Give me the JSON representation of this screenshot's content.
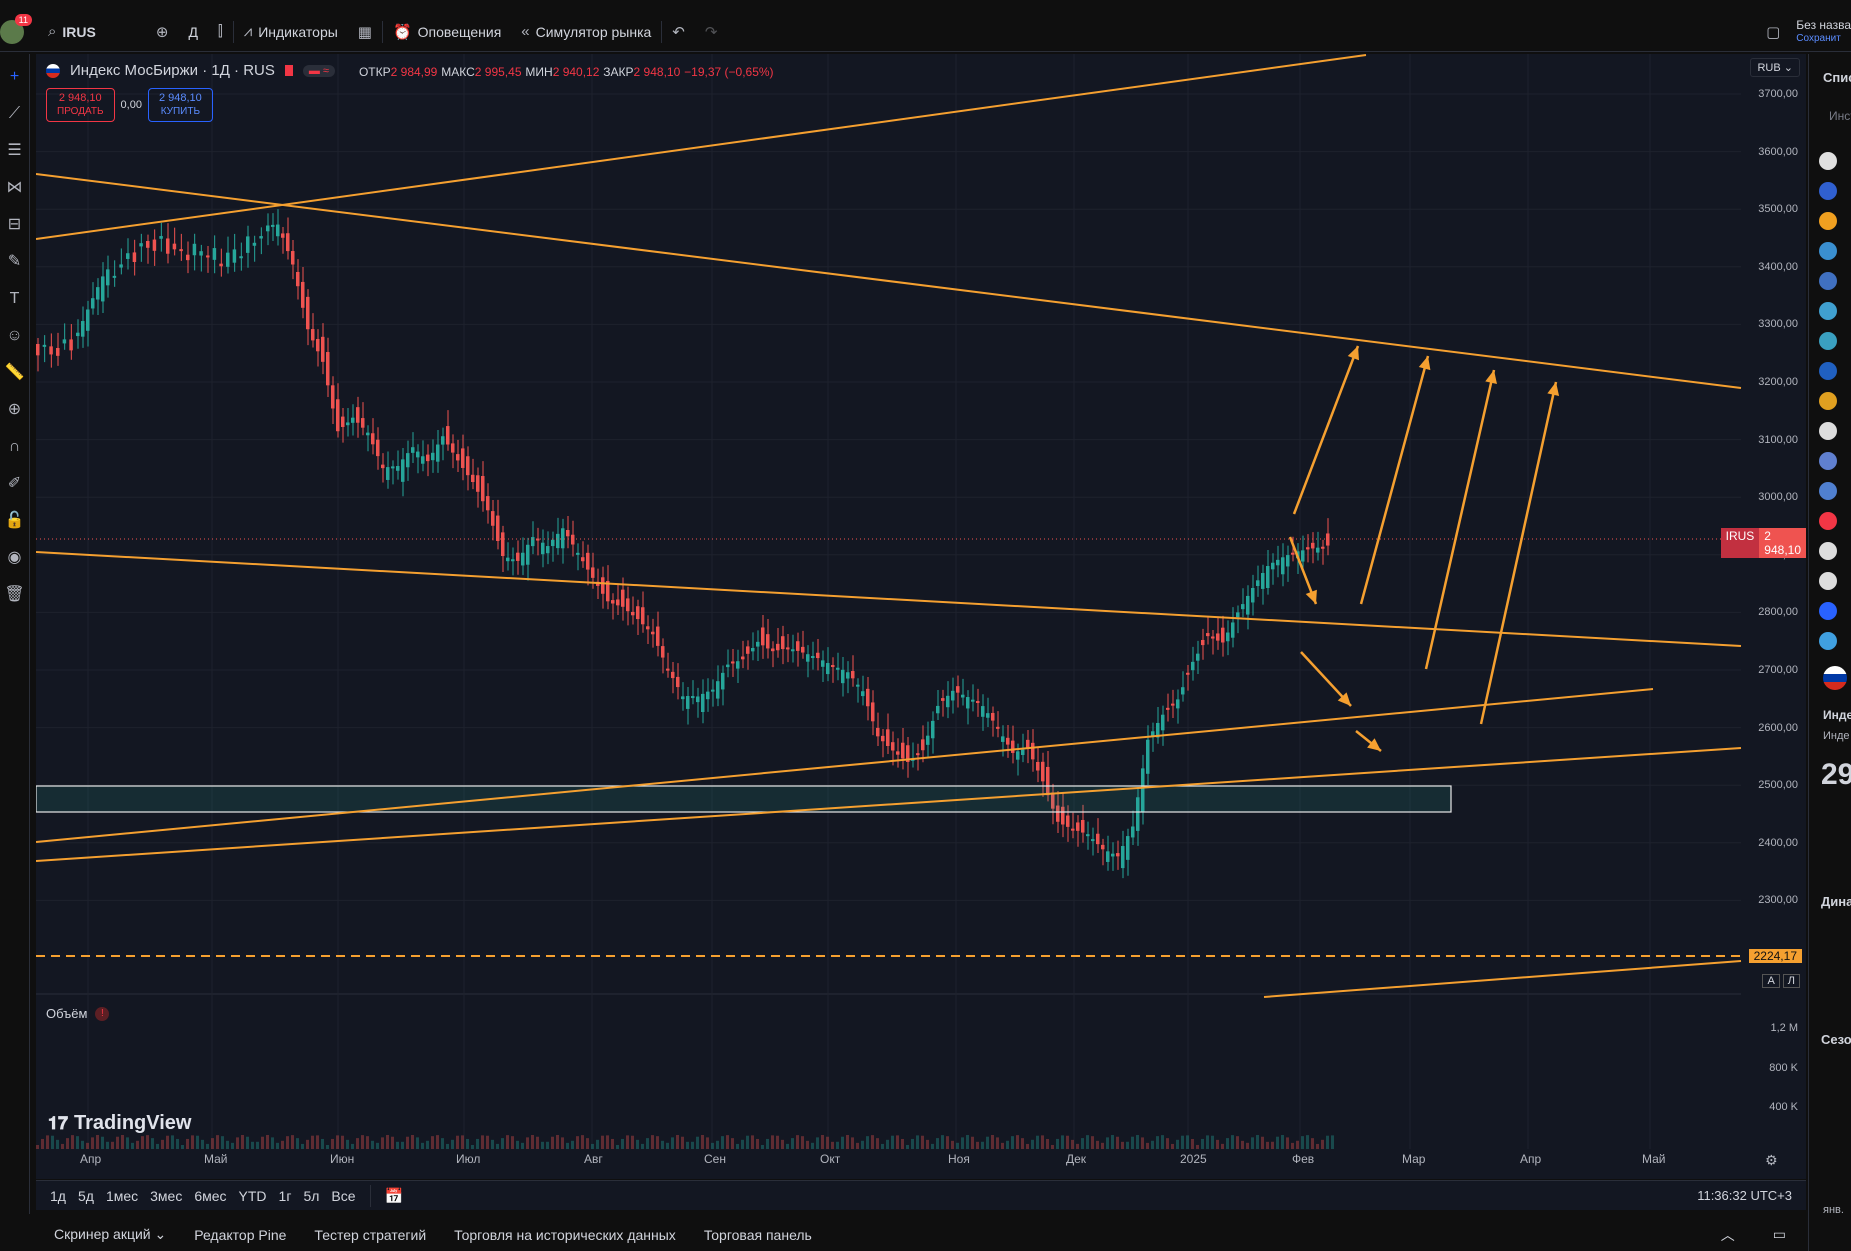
{
  "topbar": {
    "badge_count": "11",
    "symbol": "IRUS",
    "interval": "Д",
    "indicators_label": "Индикаторы",
    "alerts_label": "Оповещения",
    "replay_label": "Симулятор рынка",
    "layout_name": "Без назва",
    "save_label": "Сохранит"
  },
  "legend": {
    "title": "Индекс МосБиржи · 1Д · RUS",
    "o_key": "ОТКР",
    "o_val": "2 984,99",
    "h_key": "МАКС",
    "h_val": "2 995,45",
    "l_key": "МИН",
    "l_val": "2 940,12",
    "c_key": "ЗАКР",
    "c_val": "2 948,10",
    "change": "−19,37 (−0,65%)"
  },
  "trade": {
    "sell_price": "2 948,10",
    "sell_label": "ПРОДАТЬ",
    "spread": "0,00",
    "buy_price": "2 948,10",
    "buy_label": "КУПИТЬ"
  },
  "currency": "RUB",
  "price_labels": [
    "3700,00",
    "3600,00",
    "3500,00",
    "3400,00",
    "3300,00",
    "3200,00",
    "3100,00",
    "3000,00",
    "2900,00",
    "2800,00",
    "2700,00",
    "2600,00",
    "2500,00",
    "2400,00",
    "2300,00"
  ],
  "current": {
    "symbol": "IRUS",
    "price": "2 948,10"
  },
  "level_tag": "2224,17",
  "volume": {
    "label": "Объём",
    "labels": [
      "1,2 M",
      "800 K",
      "400 K"
    ]
  },
  "time_labels": [
    "Апр",
    "Май",
    "Июн",
    "Июл",
    "Авг",
    "Сен",
    "Окт",
    "Ноя",
    "Дек",
    "2025",
    "Фев",
    "Мар",
    "Апр",
    "Май"
  ],
  "ranges": [
    "1д",
    "5д",
    "1мес",
    "3мес",
    "6мес",
    "YTD",
    "1г",
    "5л",
    "Все"
  ],
  "clock": "11:36:32 UTC+3",
  "scale_buttons": [
    "А",
    "Л"
  ],
  "logo": "TradingView",
  "bottom_tabs": [
    "Скринер акций",
    "Редактор Pine",
    "Тестер стратегий",
    "Торговля на исторических данных",
    "Торговая панель"
  ],
  "rightpanel": {
    "watchlist_title": "Спис",
    "instruments_label": "Инст",
    "details_title": "Инде",
    "details_sub": "Инде",
    "price_partial": "29",
    "dynamics_label": "Дина",
    "season_label": "Сезо",
    "month_label": "янв."
  },
  "colors": {
    "trendline": "#f5a030",
    "up": "#26a69a",
    "down": "#ef5350",
    "bg": "#131722",
    "accent": "#2962ff"
  }
}
